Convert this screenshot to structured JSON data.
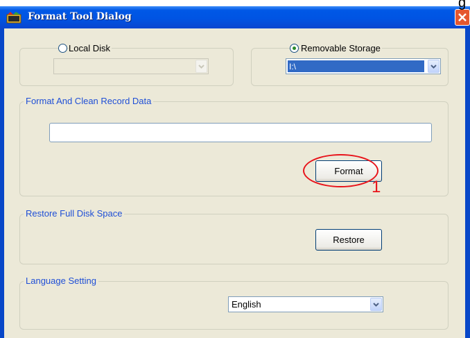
{
  "window": {
    "title": "Format Tool Dialog",
    "top_right_text": "g"
  },
  "drive_selection": {
    "local_disk": {
      "label": "Local Disk",
      "selected": false,
      "value": ""
    },
    "removable_storage": {
      "label": "Removable Storage",
      "selected": true,
      "value": "I:\\"
    }
  },
  "format_group": {
    "legend": "Format And Clean Record Data",
    "text_value": "",
    "button_label": "Format"
  },
  "restore_group": {
    "legend": "Restore Full Disk Space",
    "button_label": "Restore"
  },
  "language_group": {
    "legend": "Language Setting",
    "selected": "English"
  },
  "annotation": {
    "step_number": "1",
    "color": "#e8131a"
  },
  "colors": {
    "titlebar": "#0054e3",
    "dialog_bg": "#ece9d8",
    "legend_text": "#1f4fd6",
    "selection": "#316ac5"
  }
}
